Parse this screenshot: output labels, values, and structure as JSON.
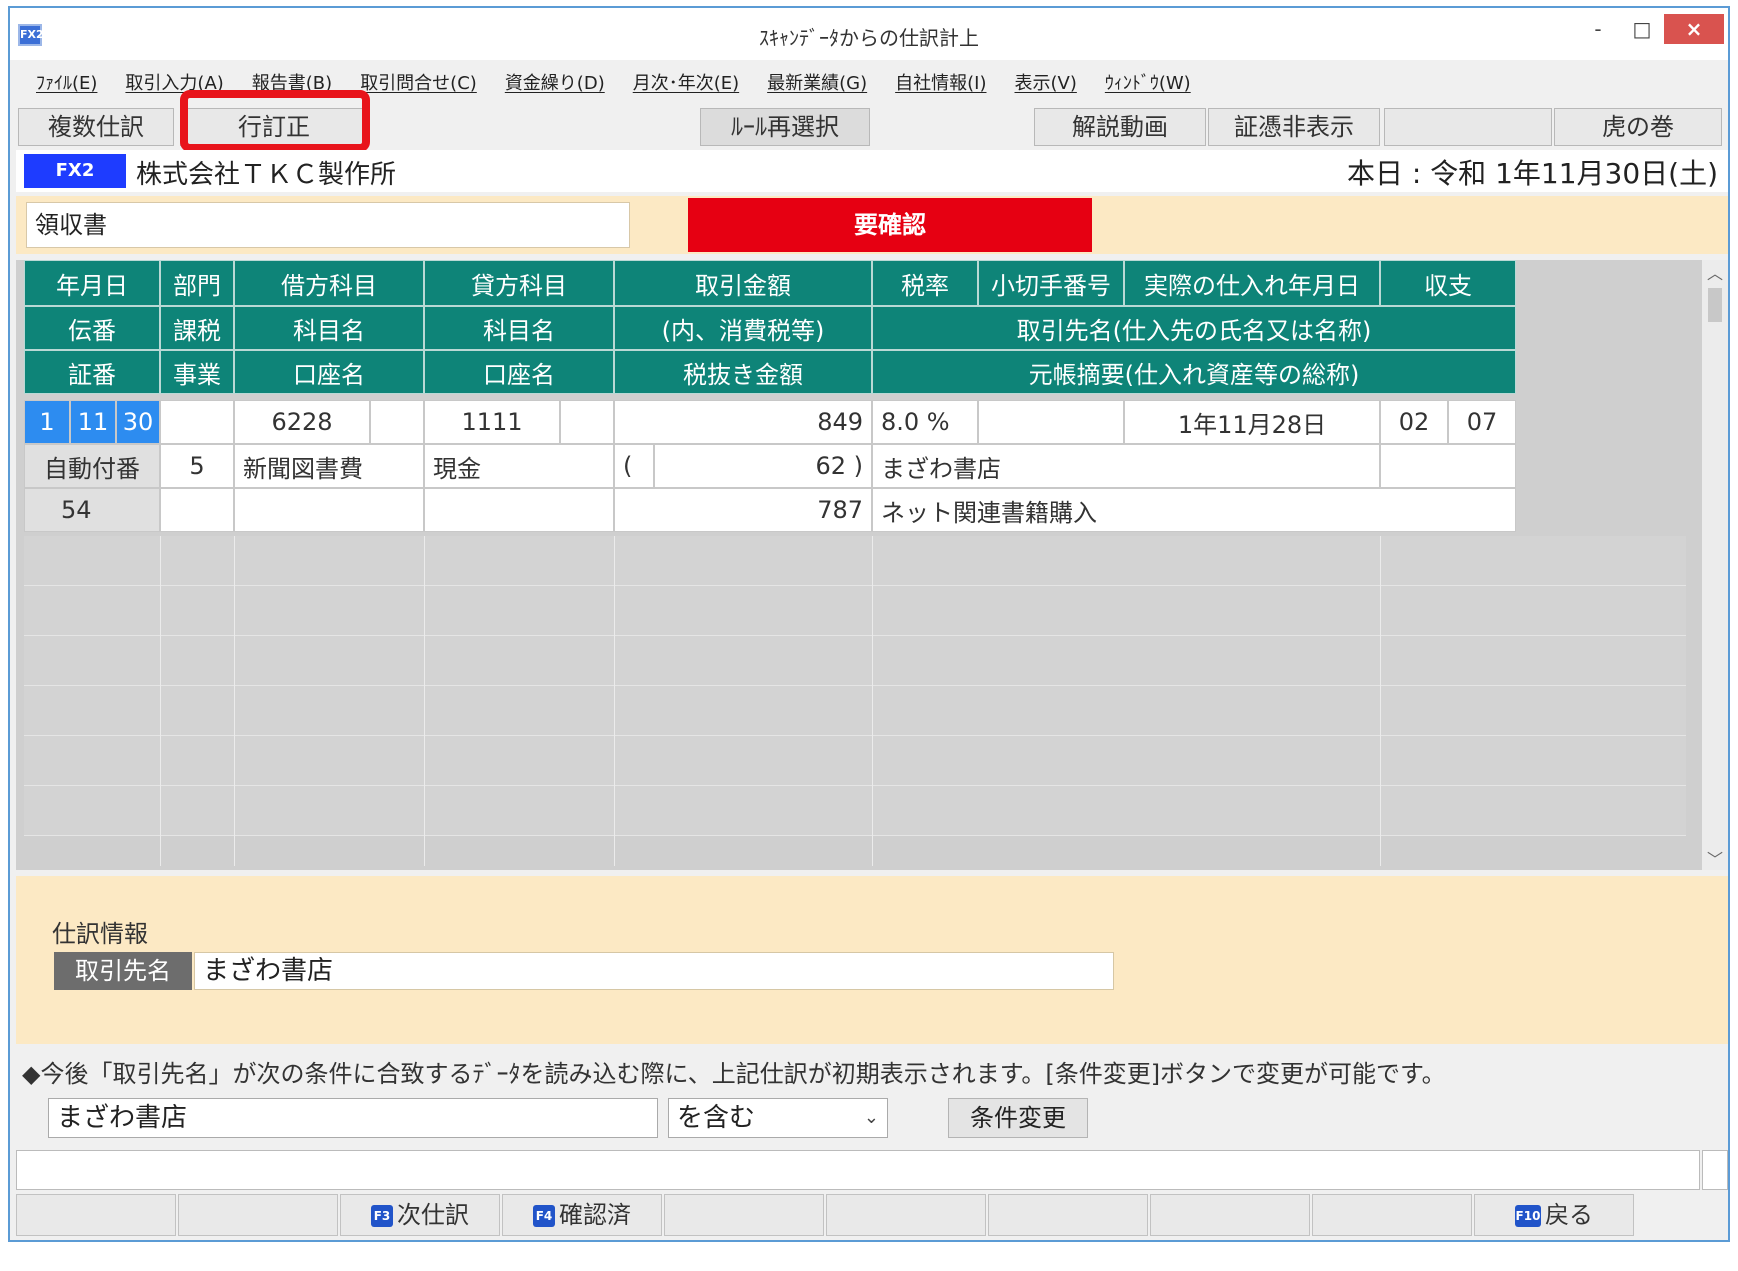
{
  "window": {
    "title": "ｽｷｬﾝﾃﾞｰﾀからの仕訳計上",
    "app_icon": "FX2",
    "min_label": "-",
    "max_label": "□",
    "close_label": "×"
  },
  "menu": [
    "ﾌｧｲﾙ(E)",
    "取引入力(A)",
    "報告書(B)",
    "取引問合せ(C)",
    "資金繰り(D)",
    "月次･年次(E)",
    "最新業績(G)",
    "自社情報(I)",
    "表示(V)",
    "ｳｨﾝﾄﾞｳ(W)"
  ],
  "toolbar": {
    "multi_journal": "複数仕訳",
    "row_correct": "行訂正",
    "rule_reselect": "ﾙｰﾙ再選択",
    "tutorial_video": "解説動画",
    "hide_voucher": "証憑非表示",
    "tora_no_maki": "虎の巻"
  },
  "company": {
    "badge": "FX2",
    "name": "株式会社ＴＫＣ製作所",
    "today": "本日 : 令和 1年11月30日(土)"
  },
  "receipt": {
    "label": "領収書",
    "confirm_button": "要確認"
  },
  "grid": {
    "headers_row1": [
      "年月日",
      "部門",
      "借方科目",
      "貸方科目",
      "取引金額",
      "税率",
      "小切手番号",
      "実際の仕入れ年月日",
      "収支"
    ],
    "headers_row2": [
      "伝番",
      "課税",
      "科目名",
      "科目名",
      "(内、消費税等)",
      "取引先名(仕入先の氏名又は名称)"
    ],
    "headers_row3": [
      "証番",
      "事業",
      "口座名",
      "口座名",
      "税抜き金額",
      "元帳摘要(仕入れ資産等の総称)"
    ],
    "entry": {
      "year": "1",
      "month": "11",
      "day": "30",
      "debit_code": "6228",
      "credit_code": "1111",
      "amount": "849",
      "tax_rate": "8.0 %",
      "purchase_date": "1年11月28日",
      "income_code1": "02",
      "income_code2": "07",
      "voucher_no": "自動付番",
      "tax_class": "5",
      "debit_name": "新聞図書費",
      "credit_name": "現金",
      "tax_open": "(",
      "tax_amount": "62 )",
      "partner": "まざわ書店",
      "proof_no": "54",
      "net_amount": "787",
      "summary": "ネット関連書籍購入"
    }
  },
  "info": {
    "title": "仕訳情報",
    "partner_label": "取引先名",
    "partner_value": "まざわ書店"
  },
  "notice": "◆今後「取引先名」が次の条件に合致するﾃﾞｰﾀを読み込む際に、上記仕訳が初期表示されます。[条件変更]ボタンで変更が可能です。",
  "condition": {
    "value": "まざわ書店",
    "operator": "を含む",
    "change_button": "条件変更"
  },
  "fkeys": {
    "next_key": "F3",
    "next_label": "次仕訳",
    "confirmed_key": "F4",
    "confirmed_label": "確認済",
    "back_key": "F10",
    "back_label": "戻る"
  },
  "colors": {
    "header_teal": "#0e8478",
    "confirm_red": "#e60012",
    "panel_beige": "#fce9c4",
    "highlight_red": "#e8141b",
    "badge_blue": "#1e3cff"
  }
}
